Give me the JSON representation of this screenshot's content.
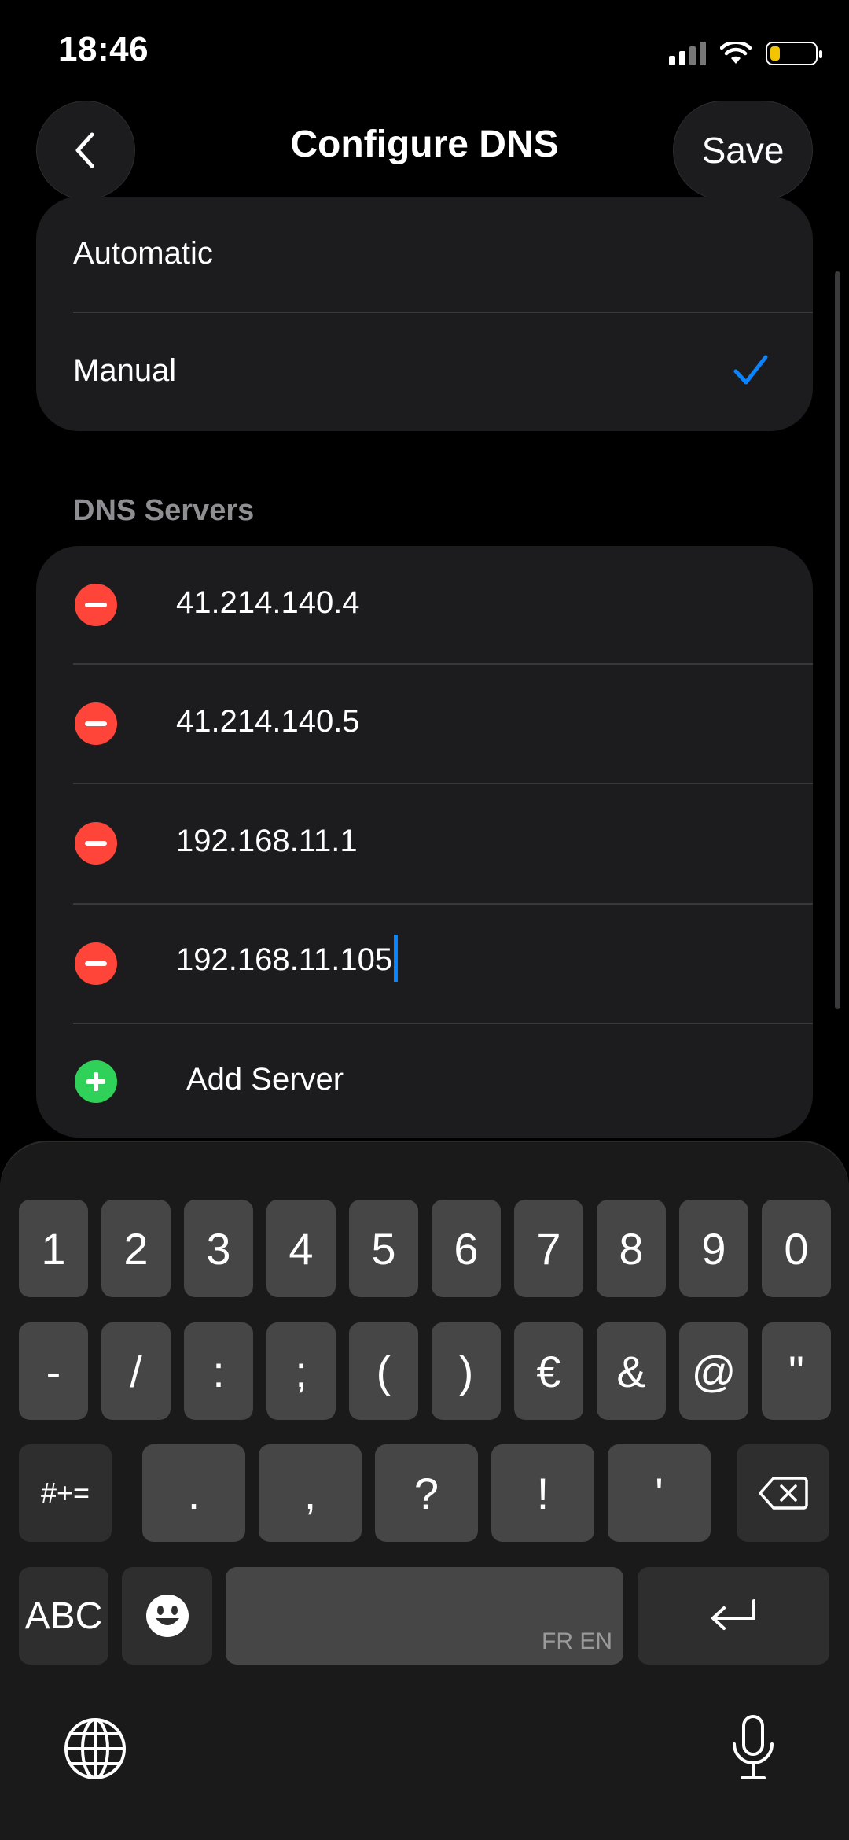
{
  "status": {
    "time": "18:46"
  },
  "nav": {
    "title": "Configure DNS",
    "save_label": "Save"
  },
  "mode": {
    "options": [
      "Automatic",
      "Manual"
    ],
    "selected": "Manual"
  },
  "dns": {
    "header": "DNS Servers",
    "servers": [
      "41.214.140.4",
      "41.214.140.5",
      "192.168.11.1",
      "192.168.11.105"
    ],
    "add_label": "Add Server"
  },
  "keyboard": {
    "row1": [
      "1",
      "2",
      "3",
      "4",
      "5",
      "6",
      "7",
      "8",
      "9",
      "0"
    ],
    "row2": [
      "-",
      "/",
      ":",
      ";",
      "(",
      ")",
      "€",
      "&",
      "@",
      "\""
    ],
    "row3": [
      ".",
      ",",
      "?",
      "!",
      "'"
    ],
    "symbols_key": "#+=",
    "abc_key": "ABC",
    "space_hint": "FR EN"
  },
  "colors": {
    "accent": "#0a84ff",
    "remove": "#ff453a",
    "add": "#30d158"
  },
  "icons": [
    "chevron-left-icon",
    "checkmark-icon",
    "wifi-icon",
    "signal-icon",
    "battery-icon",
    "backspace-icon",
    "return-icon",
    "emoji-icon",
    "globe-icon",
    "microphone-icon"
  ]
}
